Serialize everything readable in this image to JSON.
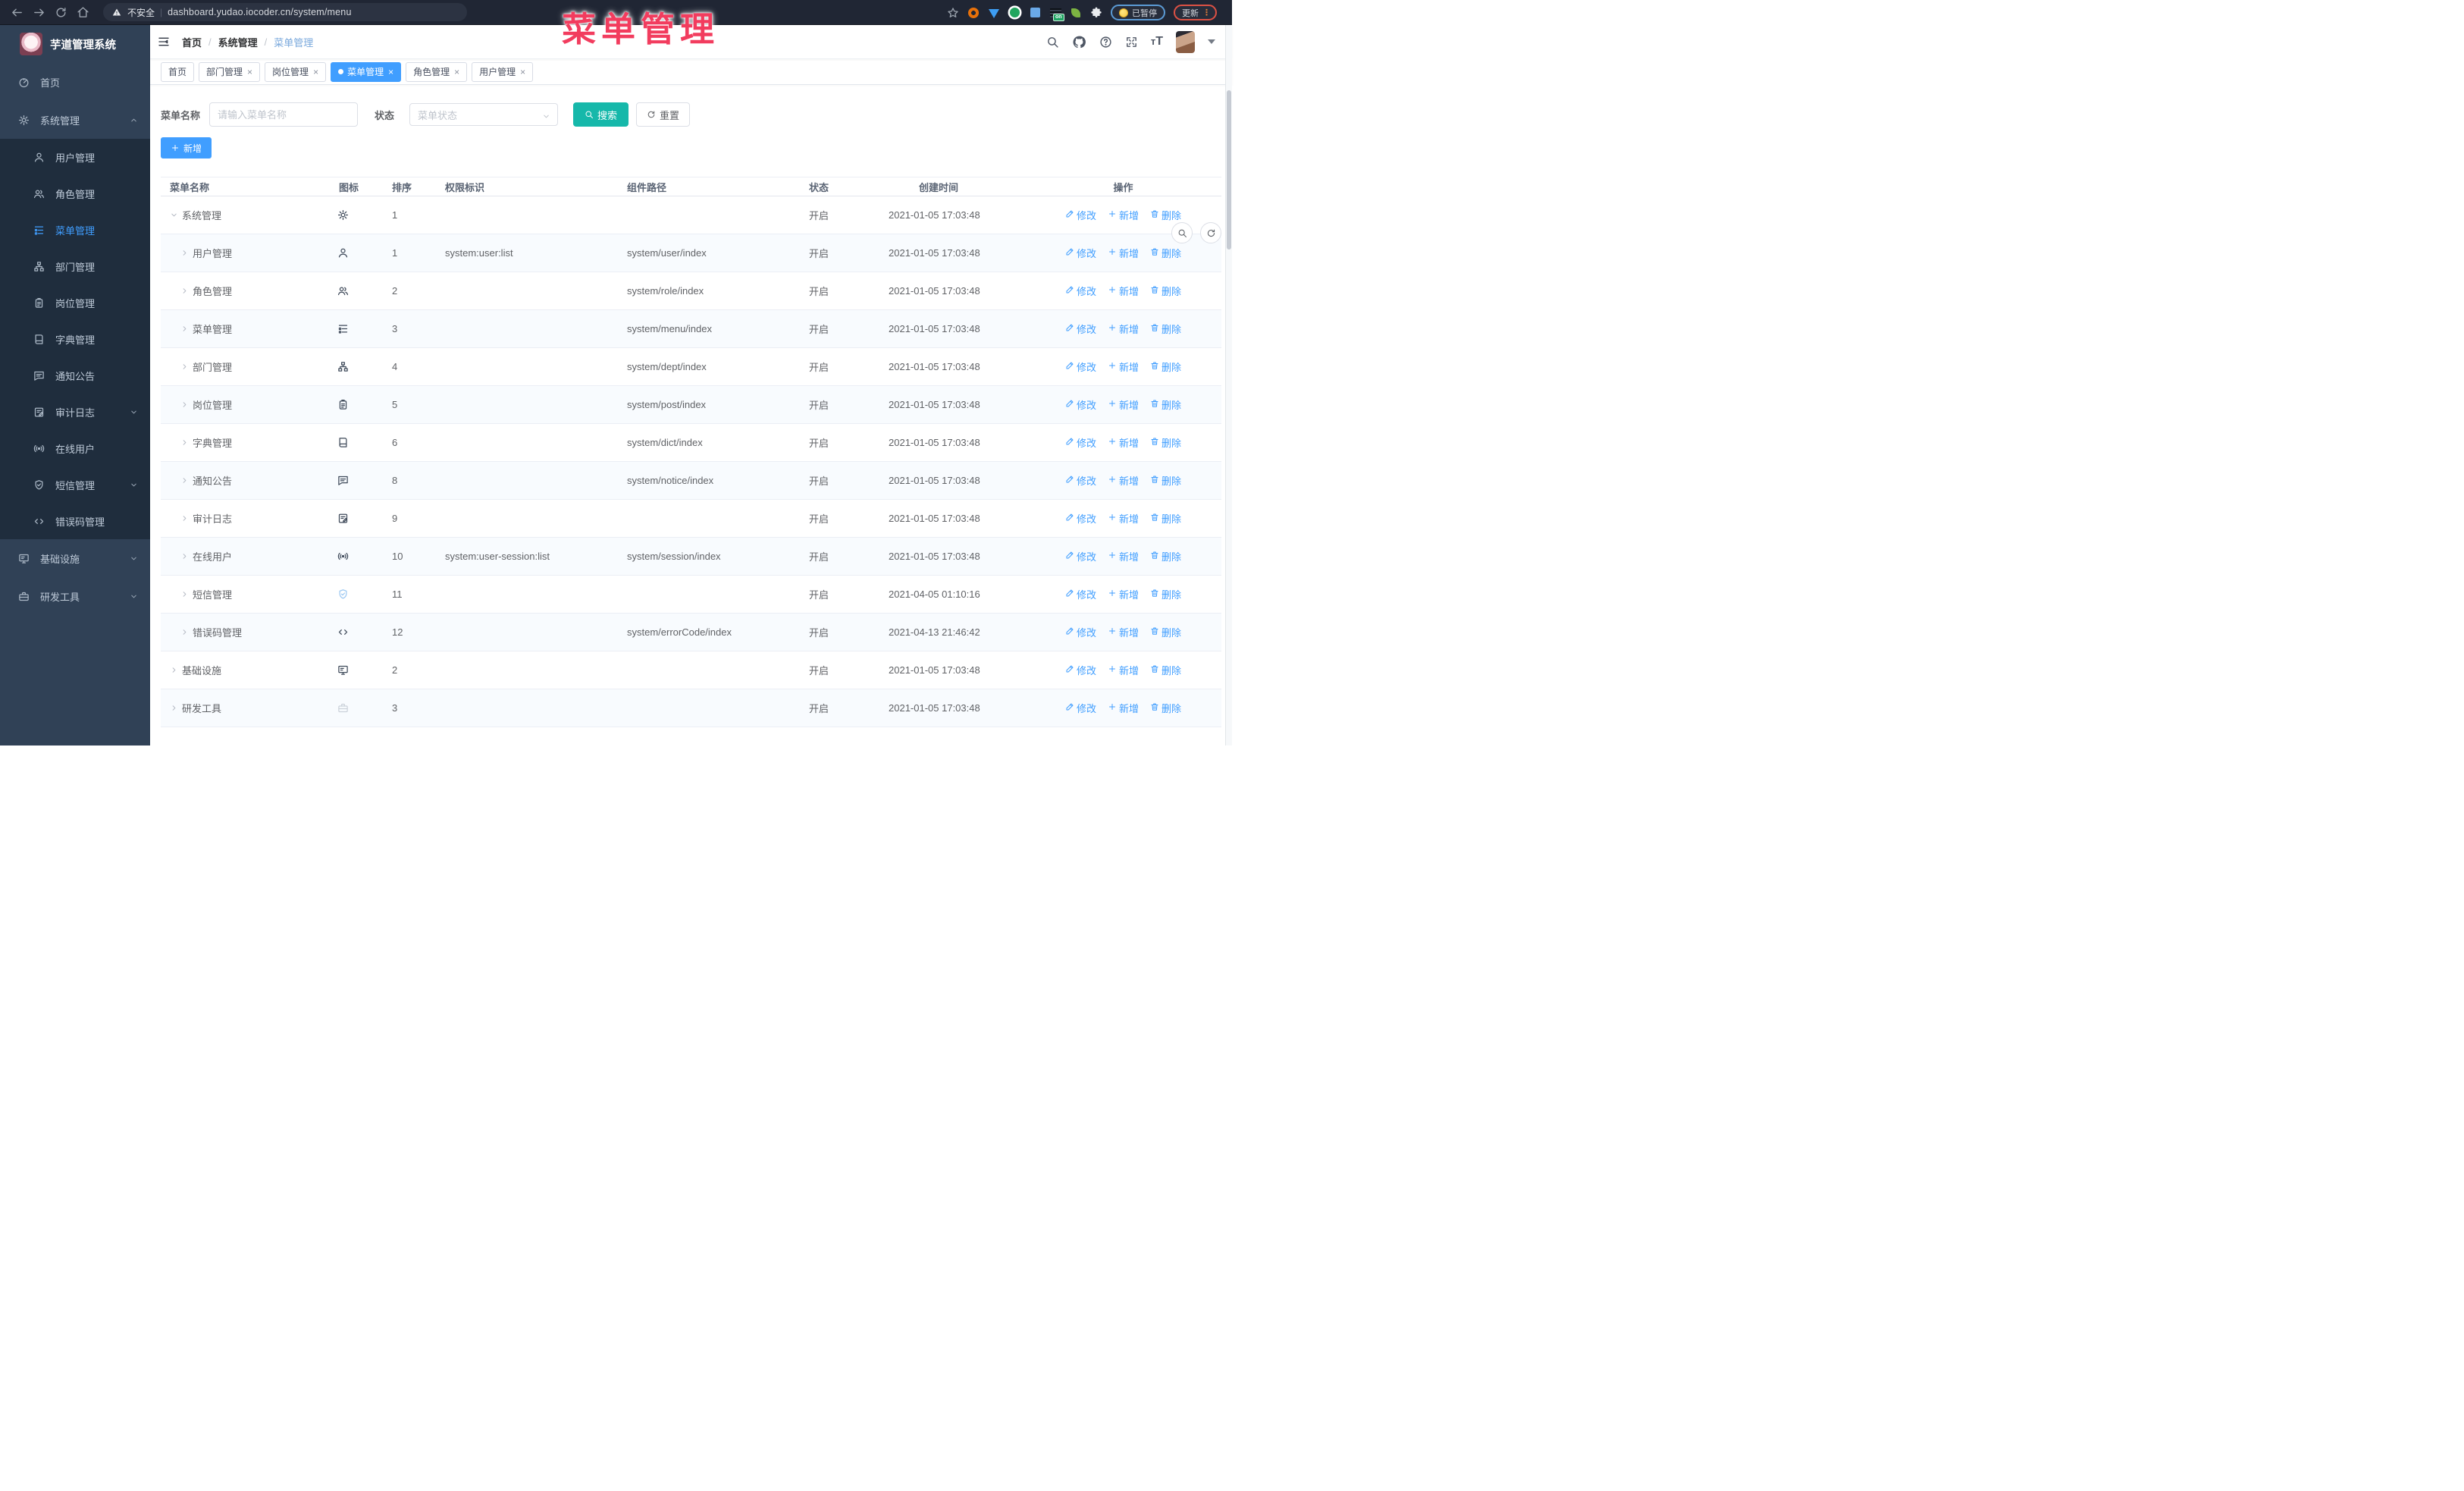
{
  "browser": {
    "security_label": "不安全",
    "url": "dashboard.yudao.iocoder.cn/system/menu",
    "paused_badge": "已暂停",
    "update_button": "更新"
  },
  "overlay_title": "菜单管理",
  "app": {
    "title": "芋道管理系统",
    "breadcrumb": [
      "首页",
      "系统管理",
      "菜单管理"
    ]
  },
  "sidebar": {
    "items": [
      {
        "label": "首页",
        "icon": "dashboard-icon"
      },
      {
        "label": "系统管理",
        "icon": "gear-icon",
        "expanded": true,
        "arrow": "up",
        "children": [
          {
            "label": "用户管理",
            "icon": "user-icon"
          },
          {
            "label": "角色管理",
            "icon": "peoples-icon"
          },
          {
            "label": "菜单管理",
            "icon": "tree-table-icon",
            "active": true
          },
          {
            "label": "部门管理",
            "icon": "tree-icon"
          },
          {
            "label": "岗位管理",
            "icon": "post-icon"
          },
          {
            "label": "字典管理",
            "icon": "dict-icon"
          },
          {
            "label": "通知公告",
            "icon": "message-icon"
          },
          {
            "label": "审计日志",
            "icon": "log-icon",
            "arrow": "down"
          },
          {
            "label": "在线用户",
            "icon": "online-icon"
          },
          {
            "label": "短信管理",
            "icon": "shield-icon",
            "arrow": "down"
          },
          {
            "label": "错误码管理",
            "icon": "code-icon"
          }
        ]
      },
      {
        "label": "基础设施",
        "icon": "monitor-icon",
        "arrow": "down"
      },
      {
        "label": "研发工具",
        "icon": "tool-icon",
        "arrow": "down"
      }
    ]
  },
  "tabs": [
    {
      "label": "首页",
      "closable": false,
      "active": false
    },
    {
      "label": "部门管理",
      "closable": true,
      "active": false
    },
    {
      "label": "岗位管理",
      "closable": true,
      "active": false
    },
    {
      "label": "菜单管理",
      "closable": true,
      "active": true
    },
    {
      "label": "角色管理",
      "closable": true,
      "active": false
    },
    {
      "label": "用户管理",
      "closable": true,
      "active": false
    }
  ],
  "search": {
    "name_label": "菜单名称",
    "name_placeholder": "请输入菜单名称",
    "status_label": "状态",
    "status_placeholder": "菜单状态",
    "search_button": "搜索",
    "reset_button": "重置"
  },
  "toolbar": {
    "add_button": "新增"
  },
  "table": {
    "columns": [
      "菜单名称",
      "图标",
      "排序",
      "权限标识",
      "组件路径",
      "状态",
      "创建时间",
      "操作"
    ],
    "actions": [
      {
        "label": "修改",
        "icon": "edit-icon"
      },
      {
        "label": "新增",
        "icon": "plus-icon"
      },
      {
        "label": "删除",
        "icon": "delete-icon"
      }
    ],
    "rows": [
      {
        "name": "系统管理",
        "depth": 0,
        "arrow": "down",
        "icon": "gear-icon",
        "sort": "1",
        "perm": "",
        "path": "",
        "status": "开启",
        "time": "2021-01-05 17:03:48"
      },
      {
        "name": "用户管理",
        "depth": 1,
        "arrow": "right",
        "icon": "user-icon",
        "sort": "1",
        "perm": "system:user:list",
        "path": "system/user/index",
        "status": "开启",
        "time": "2021-01-05 17:03:48"
      },
      {
        "name": "角色管理",
        "depth": 1,
        "arrow": "right",
        "icon": "peoples-icon",
        "sort": "2",
        "perm": "",
        "path": "system/role/index",
        "status": "开启",
        "time": "2021-01-05 17:03:48"
      },
      {
        "name": "菜单管理",
        "depth": 1,
        "arrow": "right",
        "icon": "tree-table-icon",
        "sort": "3",
        "perm": "",
        "path": "system/menu/index",
        "status": "开启",
        "time": "2021-01-05 17:03:48"
      },
      {
        "name": "部门管理",
        "depth": 1,
        "arrow": "right",
        "icon": "tree-icon",
        "sort": "4",
        "perm": "",
        "path": "system/dept/index",
        "status": "开启",
        "time": "2021-01-05 17:03:48"
      },
      {
        "name": "岗位管理",
        "depth": 1,
        "arrow": "right",
        "icon": "post-icon",
        "sort": "5",
        "perm": "",
        "path": "system/post/index",
        "status": "开启",
        "time": "2021-01-05 17:03:48"
      },
      {
        "name": "字典管理",
        "depth": 1,
        "arrow": "right",
        "icon": "dict-icon",
        "sort": "6",
        "perm": "",
        "path": "system/dict/index",
        "status": "开启",
        "time": "2021-01-05 17:03:48"
      },
      {
        "name": "通知公告",
        "depth": 1,
        "arrow": "right",
        "icon": "message-icon",
        "sort": "8",
        "perm": "",
        "path": "system/notice/index",
        "status": "开启",
        "time": "2021-01-05 17:03:48"
      },
      {
        "name": "审计日志",
        "depth": 1,
        "arrow": "right",
        "icon": "log-icon",
        "sort": "9",
        "perm": "",
        "path": "",
        "status": "开启",
        "time": "2021-01-05 17:03:48"
      },
      {
        "name": "在线用户",
        "depth": 1,
        "arrow": "right",
        "icon": "online-icon",
        "sort": "10",
        "perm": "system:user-session:list",
        "path": "system/session/index",
        "status": "开启",
        "time": "2021-01-05 17:03:48"
      },
      {
        "name": "短信管理",
        "depth": 1,
        "arrow": "right",
        "icon": "shield-icon",
        "sort": "11",
        "perm": "",
        "path": "",
        "status": "开启",
        "time": "2021-04-05 01:10:16"
      },
      {
        "name": "错误码管理",
        "depth": 1,
        "arrow": "right",
        "icon": "code-icon",
        "sort": "12",
        "perm": "",
        "path": "system/errorCode/index",
        "status": "开启",
        "time": "2021-04-13 21:46:42"
      },
      {
        "name": "基础设施",
        "depth": 0,
        "arrow": "right",
        "icon": "monitor-icon",
        "sort": "2",
        "perm": "",
        "path": "",
        "status": "开启",
        "time": "2021-01-05 17:03:48"
      },
      {
        "name": "研发工具",
        "depth": 0,
        "arrow": "right",
        "icon": "tool-icon",
        "sort": "3",
        "perm": "",
        "path": "",
        "status": "开启",
        "time": "2021-01-05 17:03:48"
      }
    ]
  }
}
